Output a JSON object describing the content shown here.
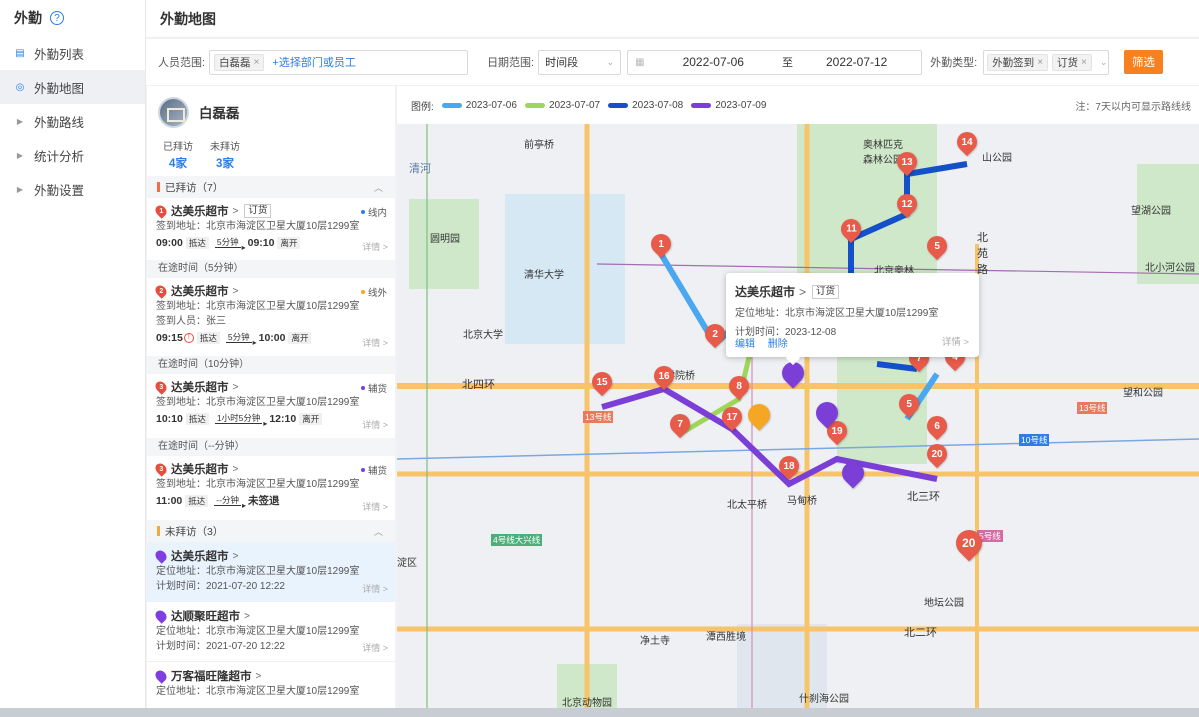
{
  "nav": {
    "title": "外勤",
    "help": "?",
    "items": [
      {
        "label": "外勤列表",
        "icon": "list-icon"
      },
      {
        "label": "外勤地图",
        "icon": "map-pin-icon"
      },
      {
        "label": "外勤路线",
        "icon": "caret-right-icon"
      },
      {
        "label": "统计分析",
        "icon": "caret-right-icon"
      },
      {
        "label": "外勤设置",
        "icon": "caret-right-icon"
      }
    ]
  },
  "page_title": "外勤地图",
  "filter": {
    "person_label": "人员范围:",
    "person_tag": "白磊磊",
    "person_link": "+选择部门或员工",
    "date_label": "日期范围:",
    "date_mode": "时间段",
    "date_start": "2022-07-06",
    "date_sep": "至",
    "date_end": "2022-07-12",
    "type_label": "外勤类型:",
    "type_tags": [
      "外勤签到",
      "订货"
    ],
    "submit": "筛选"
  },
  "legend": {
    "label": "图例:",
    "items": [
      {
        "date": "2023-07-06",
        "color": "#4aa8f0"
      },
      {
        "date": "2023-07-07",
        "color": "#9fd65a"
      },
      {
        "date": "2023-07-08",
        "color": "#1450c8"
      },
      {
        "date": "2023-07-09",
        "color": "#7b3fd8"
      }
    ],
    "note": "注：7天以内可显示路线线"
  },
  "person": {
    "name": "白磊磊",
    "visited_label": "已拜访",
    "visited_count": "4家",
    "unvisited_label": "未拜访",
    "unvisited_count": "3家"
  },
  "visited_section": "已拜访（7）",
  "unvisited_section": "未拜访（3）",
  "visited": [
    {
      "num": "1",
      "name": "达美乐超市",
      "chip": "订货",
      "tag": "线内",
      "tag_color": "#2b7de9",
      "addr": "签到地址：北京市海淀区卫星大厦10层1299室",
      "extra": "",
      "start": "09:00",
      "arrive": "抵达",
      "dur": "5分钟",
      "end": "09:10",
      "leave": "离开",
      "detail": "详情 >",
      "warn": false
    },
    {
      "num": "2",
      "name": "达美乐超市",
      "chip": "",
      "tag": "线外",
      "tag_color": "#f5a623",
      "addr": "签到地址：北京市海淀区卫星大厦10层1299室",
      "extra": "签到人员：张三",
      "start": "09:15",
      "arrive": "抵达",
      "dur": "5分钟",
      "end": "10:00",
      "leave": "离开",
      "detail": "详情 >",
      "warn": true
    },
    {
      "num": "3",
      "name": "达美乐超市",
      "chip": "",
      "tag": "辅货",
      "tag_color": "#7b3fd8",
      "addr": "签到地址：北京市海淀区卫星大厦10层1299室",
      "extra": "",
      "start": "10:10",
      "arrive": "抵达",
      "dur": "1小时5分钟",
      "end": "12:10",
      "leave": "离开",
      "detail": "详情 >",
      "warn": false
    },
    {
      "num": "3",
      "name": "达美乐超市",
      "chip": "",
      "tag": "辅货",
      "tag_color": "#7b3fd8",
      "addr": "签到地址：北京市海淀区卫星大厦10层1299室",
      "extra": "",
      "start": "11:00",
      "arrive": "抵达",
      "dur": "--分钟",
      "end": "未签退",
      "leave": "",
      "detail": "详情 >",
      "warn": false
    }
  ],
  "transits": [
    "在途时间（5分钟）",
    "在途时间（10分钟）",
    "在途时间（--分钟）"
  ],
  "unvisited": [
    {
      "name": "达美乐超市",
      "addr": "定位地址：北京市海淀区卫星大厦10层1299室",
      "plan": "计划时间：2021-07-20  12:22",
      "detail": "详情 >"
    },
    {
      "name": "达顺聚旺超市",
      "addr": "定位地址：北京市海淀区卫星大厦10层1299室",
      "plan": "计划时间：2021-07-20  12:22",
      "detail": "详情 >"
    },
    {
      "name": "万客福旺隆超市",
      "addr": "定位地址：北京市海淀区卫星大厦10层1299室",
      "plan": "",
      "detail": ""
    }
  ],
  "popup": {
    "name": "达美乐超市",
    "chip": "订货",
    "addr": "定位地址：北京市海淀区卫星大厦10层1299室",
    "plan": "计划时间：2023-12-08",
    "edit": "编辑",
    "delete": "删除",
    "detail": "详情 >"
  },
  "map_labels": {
    "qinghua": "清华大学",
    "beida": "北京大学",
    "yuanmingyuan": "圆明园",
    "qiantingqiao": "前亭桥",
    "olympic": "奥林匹克森林公园",
    "beiyuanlu": "北苑路",
    "wanghu": "望湖公园",
    "beixiaohe": "北小河公园",
    "wanghe": "望和公园",
    "xueyuanqiao": "学院桥",
    "beisihuan": "北四环",
    "beitaipingqiao": "北太平桥",
    "madianqiao": "马甸桥",
    "beisanhuan": "北三环",
    "beierhuan": "北二环",
    "ditan": "地坛公园",
    "jingtusi": "净土寺",
    "tanxichegu": "潭西胜境",
    "shichahai": "什刹海公园",
    "zoo": "北京动物园",
    "line13": "13号线",
    "line10": "10号线",
    "line4": "4号线大兴线",
    "line5": "5号线",
    "shanpark": "山公园",
    "beijingao": "北京奥林",
    "qinghe": "清河",
    "zhaiqu": "淀区"
  }
}
